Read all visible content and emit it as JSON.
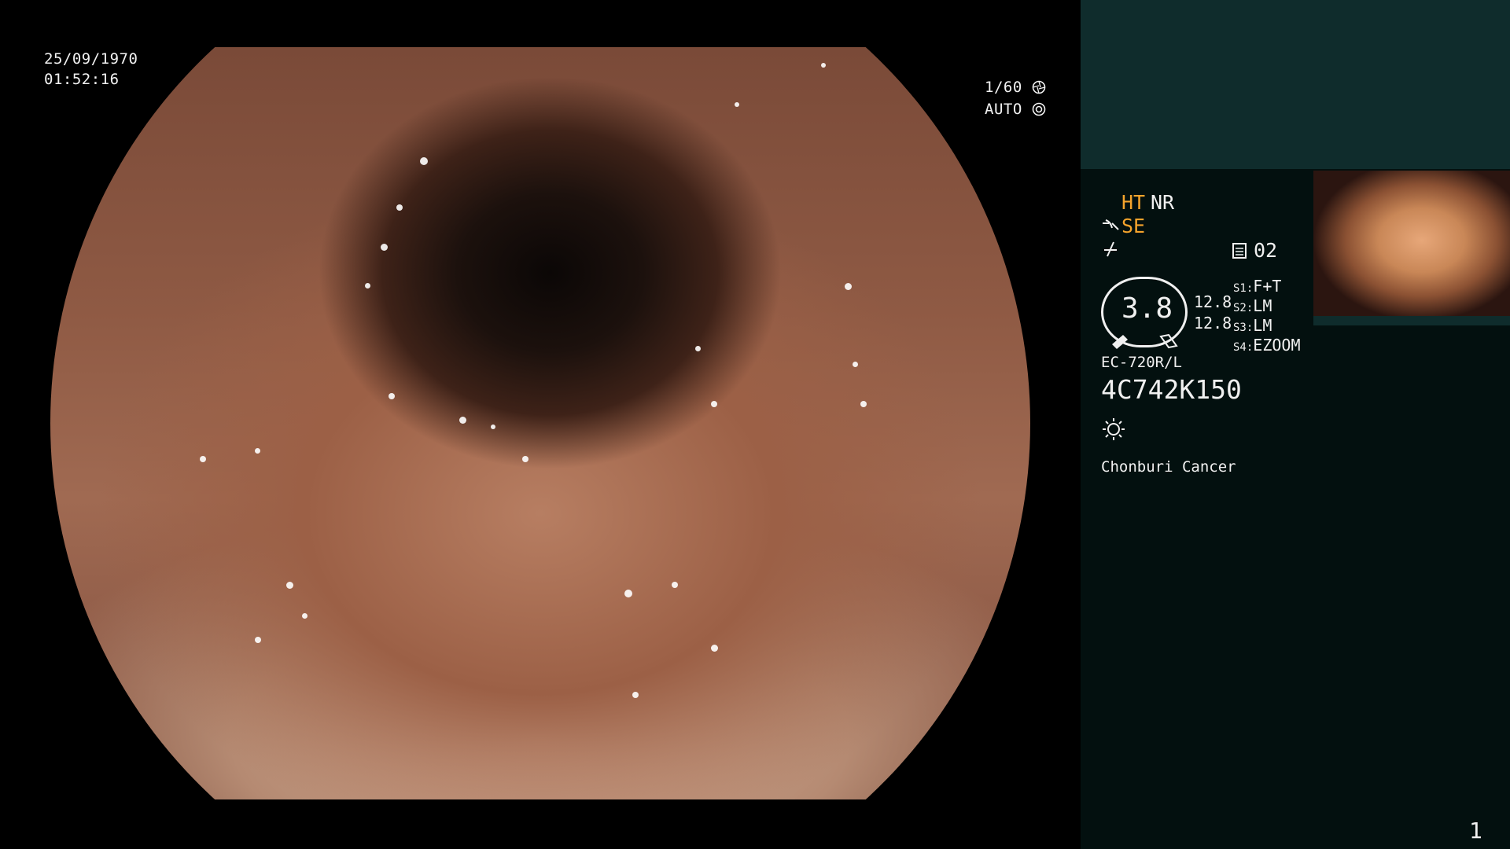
{
  "overlay": {
    "date": "25/09/1970",
    "time": "01:52:16",
    "shutter": "1/60",
    "iris": "AUTO"
  },
  "panel": {
    "ht": "HT",
    "nr": "NR",
    "se": "SE",
    "memory": "02",
    "gauge_value": "3.8",
    "scale_1": "12.8",
    "scale_2": "12.8",
    "s1_key": "S1:",
    "s1_val": "F+T",
    "s2_key": "S2:",
    "s2_val": "LM",
    "s3_key": "S3:",
    "s3_val": "LM",
    "s4_key": "S4:",
    "s4_val": "EZOOM",
    "scope_model": "EC-720R/L",
    "serial": "4C742K150",
    "institution": "Chonburi Cancer",
    "page_number": "1"
  },
  "icons": {
    "shutter": "aperture-icon",
    "iris": "iris-icon",
    "structure": "structure-enhance-icon",
    "color": "color-tone-icon",
    "memory": "memory-card-icon",
    "light": "light-sun-icon"
  },
  "colors": {
    "accent": "#f5a42c",
    "panel_bg": "#03100f",
    "panel_top": "#0f2c2c"
  }
}
